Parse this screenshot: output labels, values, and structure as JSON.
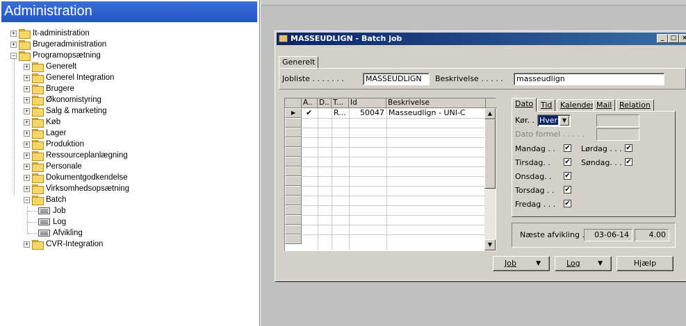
{
  "nav": {
    "title": "Administration",
    "items": [
      {
        "label": "It-administration"
      },
      {
        "label": "Brugeradministration"
      },
      {
        "label": "Programopsætning"
      },
      {
        "label": "Generelt"
      },
      {
        "label": "Generel Integration"
      },
      {
        "label": "Brugere"
      },
      {
        "label": "Økonomistyring"
      },
      {
        "label": "Salg & marketing"
      },
      {
        "label": "Køb"
      },
      {
        "label": "Lager"
      },
      {
        "label": "Produktion"
      },
      {
        "label": "Ressourceplanlægning"
      },
      {
        "label": "Personale"
      },
      {
        "label": "Dokumentgodkendelse"
      },
      {
        "label": "Virksomhedsopsætning"
      },
      {
        "label": "Batch"
      },
      {
        "label": "Job"
      },
      {
        "label": "Log"
      },
      {
        "label": "Afvikling"
      },
      {
        "label": "CVR-Integration"
      }
    ]
  },
  "window": {
    "title": "MASSEUDLIGN - Batch job",
    "min_label": "_",
    "max_label": "□",
    "close_label": "×"
  },
  "general": {
    "tab_label": "Generelt",
    "jobliste_label": "Jobliste . . . . . . .",
    "jobliste_value": "MASSEUDLIGN",
    "beskrivelse_label": "Beskrivelse . . . . .",
    "beskrivelse_value": "masseudlign"
  },
  "grid": {
    "headers": [
      "A..",
      "D..",
      "T...",
      "Id",
      "Beskrivelse"
    ],
    "rows": [
      {
        "active": "✔",
        "d": "",
        "t": "R...",
        "id": "50047",
        "desc": "Masseudlign - UNI-C"
      }
    ]
  },
  "schedule": {
    "tabs": [
      "Dato",
      "Tid",
      "Kalender",
      "Mail",
      "Relation"
    ],
    "kor_label": "Kør. .",
    "kor_value": "Hver",
    "dato_formel_label": "Dato formel . . . . .",
    "days": [
      {
        "label": "Mandag . .",
        "checked": "✔"
      },
      {
        "label": "Tirsdag. .",
        "checked": "✔"
      },
      {
        "label": "Onsdag. .",
        "checked": "✔"
      },
      {
        "label": "Torsdag . .",
        "checked": "✔"
      },
      {
        "label": "Fredag . . .",
        "checked": "✔"
      },
      {
        "label": "Lørdag . . .",
        "checked": "✔"
      },
      {
        "label": "Søndag. . .",
        "checked": "✔"
      }
    ]
  },
  "next_run": {
    "label": "Næste afvikling .",
    "date": "03-06-14",
    "time": "4.00"
  },
  "buttons": {
    "job": "Job",
    "log": "Log",
    "help": "Hjælp"
  }
}
